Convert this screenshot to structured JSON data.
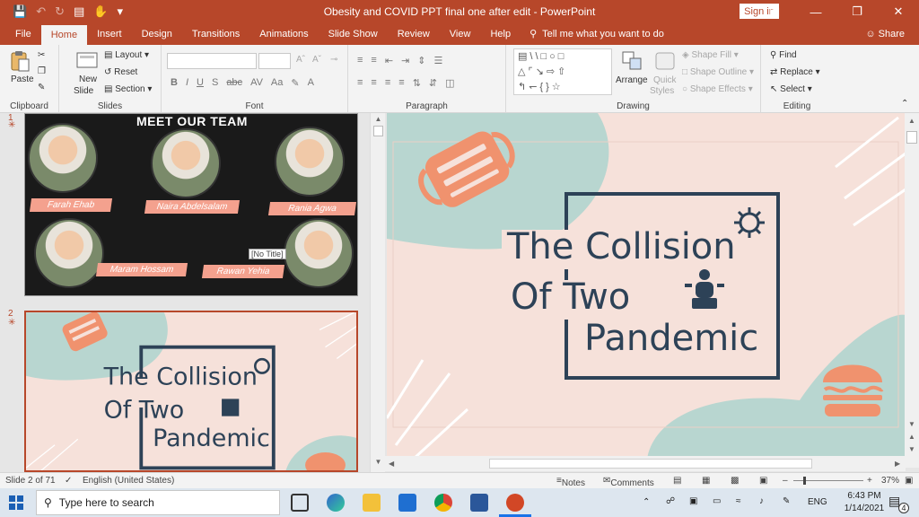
{
  "window": {
    "title": "Obesity and COVID PPT final one after edit  -  PowerPoint",
    "signin_label": "Sign in",
    "accent_color": "#b7472a"
  },
  "ribbon_tabs": [
    "File",
    "Home",
    "Insert",
    "Design",
    "Transitions",
    "Animations",
    "Slide Show",
    "Review",
    "View",
    "Help"
  ],
  "tell_me": "Tell me what you want to do",
  "share_label": "Share",
  "ribbon": {
    "clipboard": {
      "paste": "Paste",
      "label": "Clipboard"
    },
    "slides": {
      "new_slide": "New",
      "new_slide_2": "Slide",
      "layout": "Layout",
      "reset": "Reset",
      "section": "Section",
      "label": "Slides"
    },
    "font": {
      "label": "Font"
    },
    "paragraph": {
      "label": "Paragraph"
    },
    "drawing": {
      "arrange": "Arrange",
      "quick_styles": "Quick",
      "quick_styles_2": "Styles",
      "shape_fill": "Shape Fill",
      "shape_outline": "Shape Outline",
      "shape_effects": "Shape Effects",
      "label": "Drawing"
    },
    "editing": {
      "find": "Find",
      "replace": "Replace",
      "select": "Select",
      "label": "Editing"
    }
  },
  "thumbnails": {
    "slide1_number": "1",
    "slide2_number": "2",
    "team_title": "MEET OUR TEAM",
    "members": [
      "Farah Ehab",
      "Naira Abdelsalam",
      "Rania Agwa",
      "Maram Hossam",
      "Rawan Yehia"
    ],
    "no_title_tooltip": "[No Title]"
  },
  "slide": {
    "line1": "The Collision",
    "line2": "Of Two",
    "line3": "Pandemic",
    "bg_color": "#f6e1da",
    "accent_shape_color": "#b8d6d0",
    "icon_color": "#f0926e",
    "text_color": "#2d4257"
  },
  "status": {
    "slide_info": "Slide 2 of 71",
    "language": "English (United States)",
    "notes": "Notes",
    "comments": "Comments",
    "zoom": "37%"
  },
  "taskbar": {
    "search_placeholder": "Type here to search",
    "language": "ENG",
    "time": "6:43 PM",
    "date": "1/14/2021",
    "notification_count": "4"
  }
}
